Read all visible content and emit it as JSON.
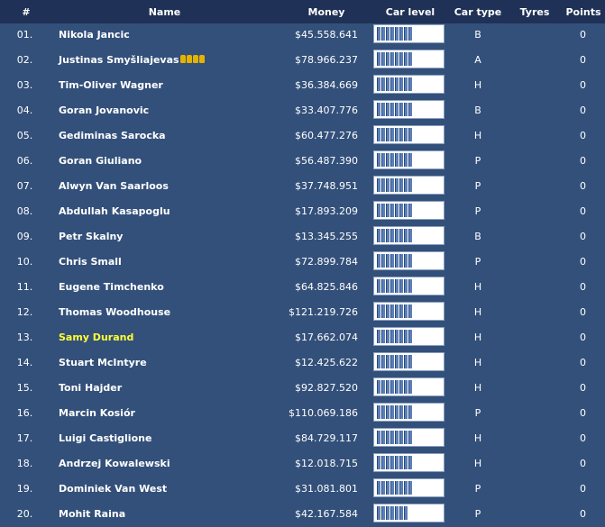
{
  "header": {
    "rank": "#",
    "name": "Name",
    "money": "Money",
    "car_level": "Car level",
    "car_type": "Car type",
    "tyres": "Tyres",
    "points": "Points"
  },
  "colors": {
    "background": "#33507a",
    "header": "#1f3156",
    "highlight_name": "#ffff33",
    "car_level_fill": "#5b7fb6",
    "trophy": "#e5b200"
  },
  "rows": [
    {
      "rank": "01.",
      "name": "Nikola Jancic",
      "money": "$45.558.641",
      "car_level": 8,
      "car_type": "B",
      "tyres": "",
      "points": "0"
    },
    {
      "rank": "02.",
      "name": "Justinas Smyšliajevas",
      "trophies": 4,
      "money": "$78.966.237",
      "car_level": 8,
      "car_type": "A",
      "tyres": "",
      "points": "0"
    },
    {
      "rank": "03.",
      "name": "Tim-Oliver Wagner",
      "money": "$36.384.669",
      "car_level": 8,
      "car_type": "H",
      "tyres": "",
      "points": "0"
    },
    {
      "rank": "04.",
      "name": "Goran Jovanovic",
      "money": "$33.407.776",
      "car_level": 8,
      "car_type": "B",
      "tyres": "",
      "points": "0"
    },
    {
      "rank": "05.",
      "name": "Gediminas Sarocka",
      "money": "$60.477.276",
      "car_level": 8,
      "car_type": "H",
      "tyres": "",
      "points": "0"
    },
    {
      "rank": "06.",
      "name": "Goran Giuliano",
      "money": "$56.487.390",
      "car_level": 8,
      "car_type": "P",
      "tyres": "",
      "points": "0"
    },
    {
      "rank": "07.",
      "name": "Alwyn Van Saarloos",
      "money": "$37.748.951",
      "car_level": 8,
      "car_type": "P",
      "tyres": "",
      "points": "0"
    },
    {
      "rank": "08.",
      "name": "Abdullah Kasapoglu",
      "money": "$17.893.209",
      "car_level": 8,
      "car_type": "P",
      "tyres": "",
      "points": "0"
    },
    {
      "rank": "09.",
      "name": "Petr Skalny",
      "money": "$13.345.255",
      "car_level": 8,
      "car_type": "B",
      "tyres": "",
      "points": "0"
    },
    {
      "rank": "10.",
      "name": "Chris Small",
      "money": "$72.899.784",
      "car_level": 8,
      "car_type": "P",
      "tyres": "",
      "points": "0"
    },
    {
      "rank": "11.",
      "name": "Eugene Timchenko",
      "money": "$64.825.846",
      "car_level": 8,
      "car_type": "H",
      "tyres": "",
      "points": "0"
    },
    {
      "rank": "12.",
      "name": "Thomas Woodhouse",
      "money": "$121.219.726",
      "car_level": 8,
      "car_type": "H",
      "tyres": "",
      "points": "0"
    },
    {
      "rank": "13.",
      "name": "Samy Durand",
      "highlight": true,
      "money": "$17.662.074",
      "car_level": 8,
      "car_type": "H",
      "tyres": "",
      "points": "0"
    },
    {
      "rank": "14.",
      "name": "Stuart McIntyre",
      "money": "$12.425.622",
      "car_level": 8,
      "car_type": "H",
      "tyres": "",
      "points": "0"
    },
    {
      "rank": "15.",
      "name": "Toni Hajder",
      "money": "$92.827.520",
      "car_level": 8,
      "car_type": "H",
      "tyres": "",
      "points": "0"
    },
    {
      "rank": "16.",
      "name": "Marcin Kosiór",
      "money": "$110.069.186",
      "car_level": 8,
      "car_type": "P",
      "tyres": "",
      "points": "0"
    },
    {
      "rank": "17.",
      "name": "Luigi Castiglione",
      "money": "$84.729.117",
      "car_level": 8,
      "car_type": "H",
      "tyres": "",
      "points": "0"
    },
    {
      "rank": "18.",
      "name": "Andrzej Kowalewski",
      "money": "$12.018.715",
      "car_level": 8,
      "car_type": "H",
      "tyres": "",
      "points": "0"
    },
    {
      "rank": "19.",
      "name": "Dominiek Van West",
      "money": "$31.081.801",
      "car_level": 8,
      "car_type": "P",
      "tyres": "",
      "points": "0"
    },
    {
      "rank": "20.",
      "name": "Mohit Raina",
      "money": "$42.167.584",
      "car_level": 7,
      "car_type": "P",
      "tyres": "",
      "points": "0"
    }
  ]
}
